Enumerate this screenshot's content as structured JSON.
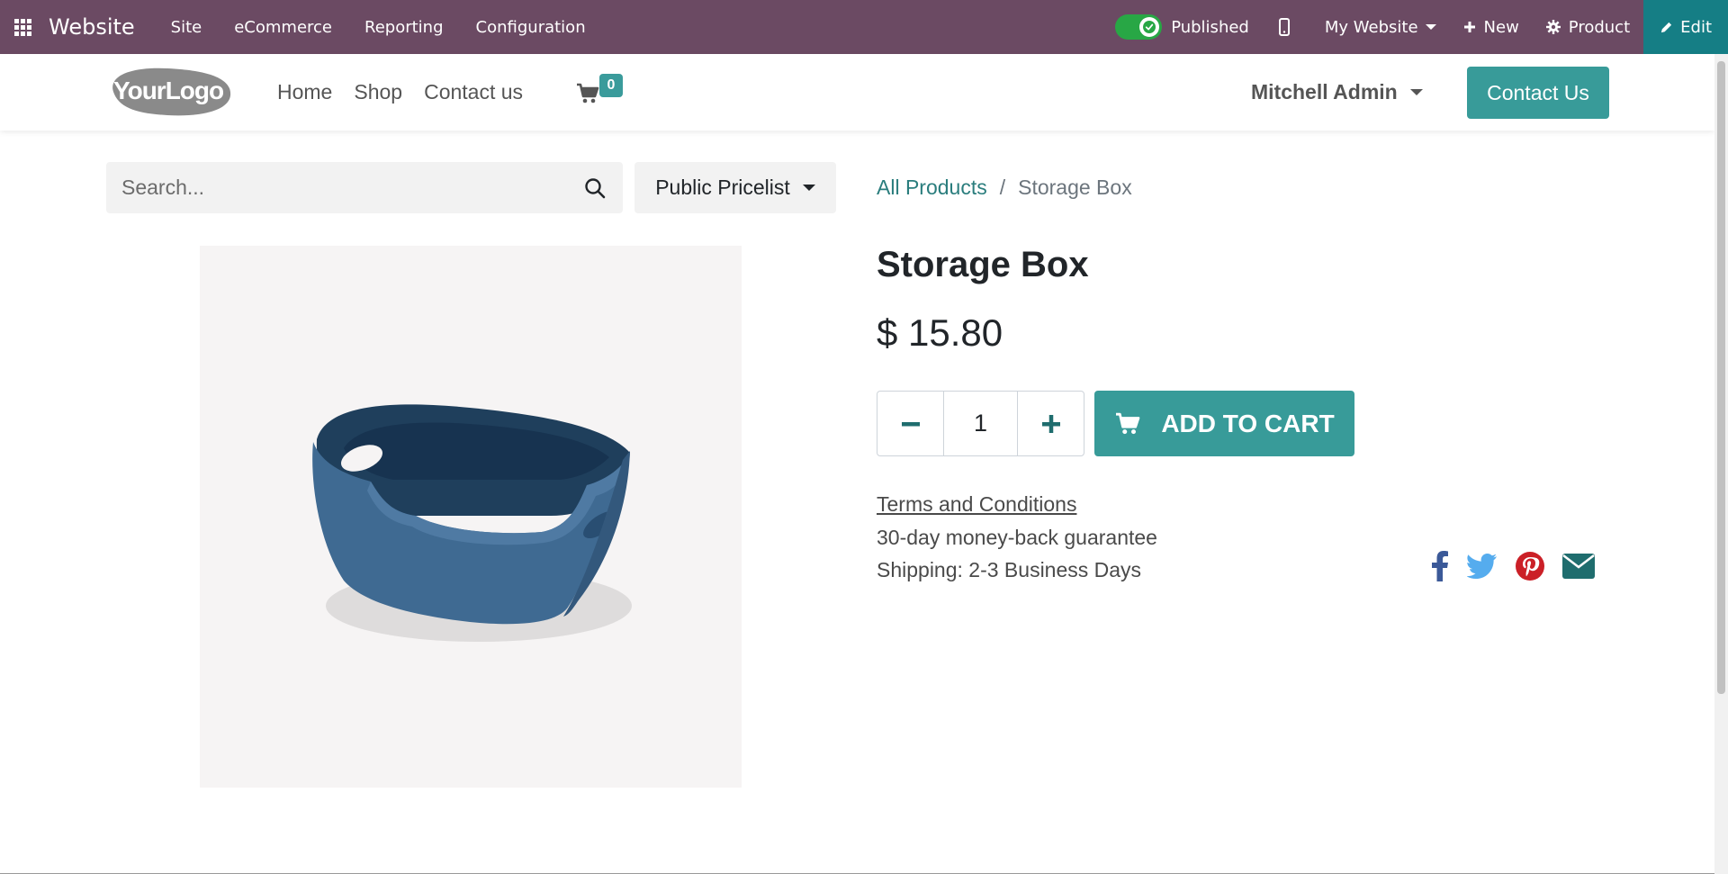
{
  "admin_bar": {
    "app_name": "Website",
    "menu": [
      "Site",
      "eCommerce",
      "Reporting",
      "Configuration"
    ],
    "published_label": "Published",
    "website_label": "My Website",
    "new_label": "New",
    "product_label": "Product",
    "edit_label": "Edit",
    "bg_color": "#6b4a63",
    "edit_color": "#157e85"
  },
  "header": {
    "logo_text": "YourLogo",
    "nav": [
      "Home",
      "Shop",
      "Contact us"
    ],
    "cart_count": "0",
    "user_name": "Mitchell Admin",
    "contact_button": "Contact Us",
    "accent_color": "#389b99"
  },
  "search": {
    "placeholder": "Search...",
    "pricelist": "Public Pricelist"
  },
  "breadcrumb": {
    "all_products": "All Products",
    "separator": "/",
    "current": "Storage Box"
  },
  "product": {
    "name": "Storage Box",
    "price": "$ 15.80",
    "quantity": "1",
    "add_to_cart": "ADD TO CART",
    "terms": "Terms and Conditions",
    "guarantee": "30-day money-back guarantee",
    "shipping": "Shipping: 2-3 Business Days",
    "image_icon": "storage-box-image"
  },
  "share_icons": [
    "facebook-icon",
    "twitter-icon",
    "pinterest-icon",
    "envelope-icon"
  ]
}
